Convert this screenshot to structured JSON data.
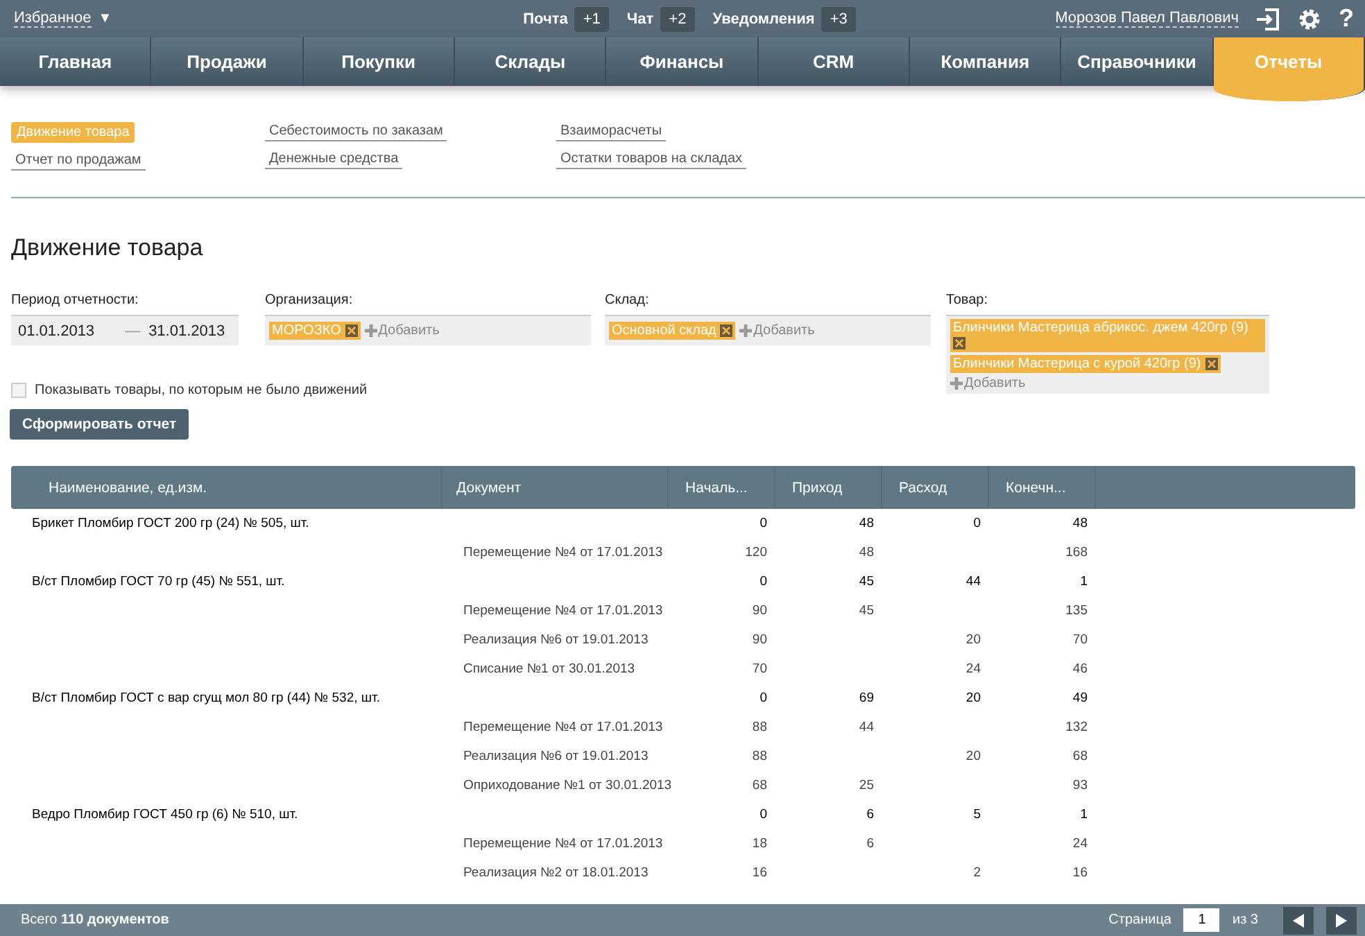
{
  "topbar": {
    "favorites": "Избранное",
    "caret": "▼",
    "counters": [
      {
        "label": "Почта",
        "count": "+1"
      },
      {
        "label": "Чат",
        "count": "+2"
      },
      {
        "label": "Уведомления",
        "count": "+3"
      }
    ],
    "user": "Морозов Павел Павлович",
    "help": "?"
  },
  "nav": [
    {
      "label": "Главная",
      "selected": false
    },
    {
      "label": "Продажи",
      "selected": false
    },
    {
      "label": "Покупки",
      "selected": false
    },
    {
      "label": "Склады",
      "selected": false
    },
    {
      "label": "Финансы",
      "selected": false
    },
    {
      "label": "CRM",
      "selected": false
    },
    {
      "label": "Компания",
      "selected": false
    },
    {
      "label": "Справочники",
      "selected": false
    },
    {
      "label": "Отчеты",
      "selected": true
    }
  ],
  "report_links": [
    [
      {
        "label": "Движение товара",
        "selected": true
      },
      {
        "label": "Отчет по продажам",
        "selected": false
      }
    ],
    [
      {
        "label": "Себестоимость по заказам",
        "selected": false
      },
      {
        "label": "Денежные средства",
        "selected": false
      }
    ],
    [
      {
        "label": "Взаиморасчеты",
        "selected": false
      },
      {
        "label": "Остатки товаров на складах",
        "selected": false
      }
    ]
  ],
  "title": "Движение товара",
  "filters": {
    "period": {
      "label": "Период отчетности:",
      "from": "01.01.2013",
      "dash": "—",
      "to": "31.01.2013"
    },
    "tag_fields": [
      {
        "label": "Организация:",
        "tags": [
          "МОРОЗКО"
        ],
        "add": "Добавить"
      },
      {
        "label": "Склад:",
        "tags": [
          "Основной склад"
        ],
        "add": "Добавить"
      },
      {
        "label": "Товар:",
        "tags": [
          "Блинчики Мастерица абрикос. джем 420гр (9)",
          "Блинчики Мастерица с курой 420гр (9)"
        ],
        "add": "Добавить"
      }
    ]
  },
  "show_empty": {
    "label": "Показывать товары, по которым не было движений",
    "checked": false
  },
  "submit": "Сформировать отчет",
  "table": {
    "columns": [
      "Наименование, ед.изм.",
      "Документ",
      "Началь...",
      "Приход",
      "Расход",
      "Конечн..."
    ],
    "rows": [
      {
        "kind": "item",
        "cells": [
          "Брикет Пломбир ГОСТ 200 гр (24) № 505, шт.",
          "",
          "0",
          "48",
          "0",
          "48"
        ]
      },
      {
        "kind": "doc",
        "cells": [
          "",
          "Перемещение №4 от 17.01.2013",
          "120",
          "48",
          "",
          "168"
        ]
      },
      {
        "kind": "item",
        "cells": [
          "В/ст Пломбир ГОСТ 70 гр (45) № 551, шт.",
          "",
          "0",
          "45",
          "44",
          "1"
        ]
      },
      {
        "kind": "doc",
        "cells": [
          "",
          "Перемещение №4 от 17.01.2013",
          "90",
          "45",
          "",
          "135"
        ]
      },
      {
        "kind": "doc",
        "cells": [
          "",
          "Реализация №6 от 19.01.2013",
          "90",
          "",
          "20",
          "70"
        ]
      },
      {
        "kind": "doc",
        "cells": [
          "",
          "Списание №1 от 30.01.2013",
          "70",
          "",
          "24",
          "46"
        ]
      },
      {
        "kind": "item",
        "cells": [
          "В/ст Пломбир ГОСТ с вар сгущ мол 80 гр (44) № 532, шт.",
          "",
          "0",
          "69",
          "20",
          "49"
        ]
      },
      {
        "kind": "doc",
        "cells": [
          "",
          "Перемещение №4 от 17.01.2013",
          "88",
          "44",
          "",
          "132"
        ]
      },
      {
        "kind": "doc",
        "cells": [
          "",
          "Реализация №6 от 19.01.2013",
          "88",
          "",
          "20",
          "68"
        ]
      },
      {
        "kind": "doc",
        "cells": [
          "",
          "Оприходование №1 от 30.01.2013",
          "68",
          "25",
          "",
          "93"
        ]
      },
      {
        "kind": "item",
        "cells": [
          "Ведро Пломбир ГОСТ 450 гр (6) № 510, шт.",
          "",
          "0",
          "6",
          "5",
          "1"
        ]
      },
      {
        "kind": "doc",
        "cells": [
          "",
          "Перемещение №4 от 17.01.2013",
          "18",
          "6",
          "",
          "24"
        ]
      },
      {
        "kind": "doc",
        "cells": [
          "",
          "Реализация №2 от 18.01.2013",
          "16",
          "",
          "2",
          "16"
        ]
      }
    ]
  },
  "footer": {
    "total_prefix": "Всего",
    "total": "110 документов",
    "page_label": "Страница",
    "page": "1",
    "of": "из 3"
  }
}
